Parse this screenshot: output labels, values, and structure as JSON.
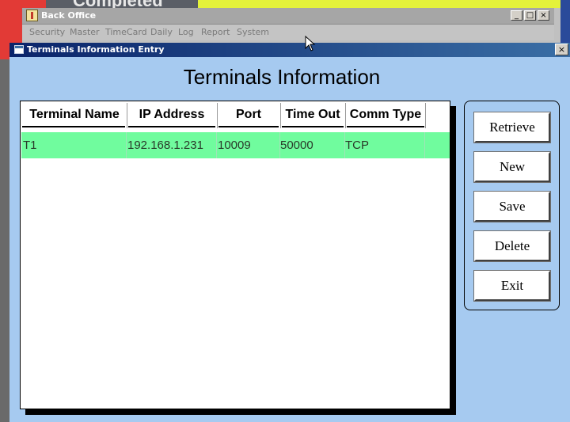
{
  "background": {
    "completed_text": "Completed"
  },
  "main_window": {
    "title": "Back Office",
    "controls": {
      "minimize": "_",
      "maximize": "□",
      "close": "×"
    },
    "menu": [
      "Security",
      "Master",
      "TimeCard",
      "Daily",
      "Log",
      "Report",
      "System"
    ]
  },
  "dialog": {
    "title": "Terminals Information Entry",
    "close": "×",
    "heading": "Terminals Information",
    "grid": {
      "columns": [
        "Terminal Name",
        "IP Address",
        "Port",
        "Time Out",
        "Comm Type"
      ],
      "rows": [
        [
          "T1",
          "192.168.1.231",
          "10009",
          "50000",
          "TCP"
        ]
      ]
    },
    "buttons": {
      "retrieve": "Retrieve",
      "new": "New",
      "save": "Save",
      "delete": "Delete",
      "exit": "Exit"
    }
  },
  "colors": {
    "dialog_bg": "#a6caf0",
    "selected_row": "#70fc9e",
    "titlebar_start": "#0a246a",
    "titlebar_end": "#3a6ea5"
  },
  "icons": {
    "app": "back-office-app-icon",
    "dialog": "window-icon",
    "cursor": "mouse-pointer-icon"
  }
}
